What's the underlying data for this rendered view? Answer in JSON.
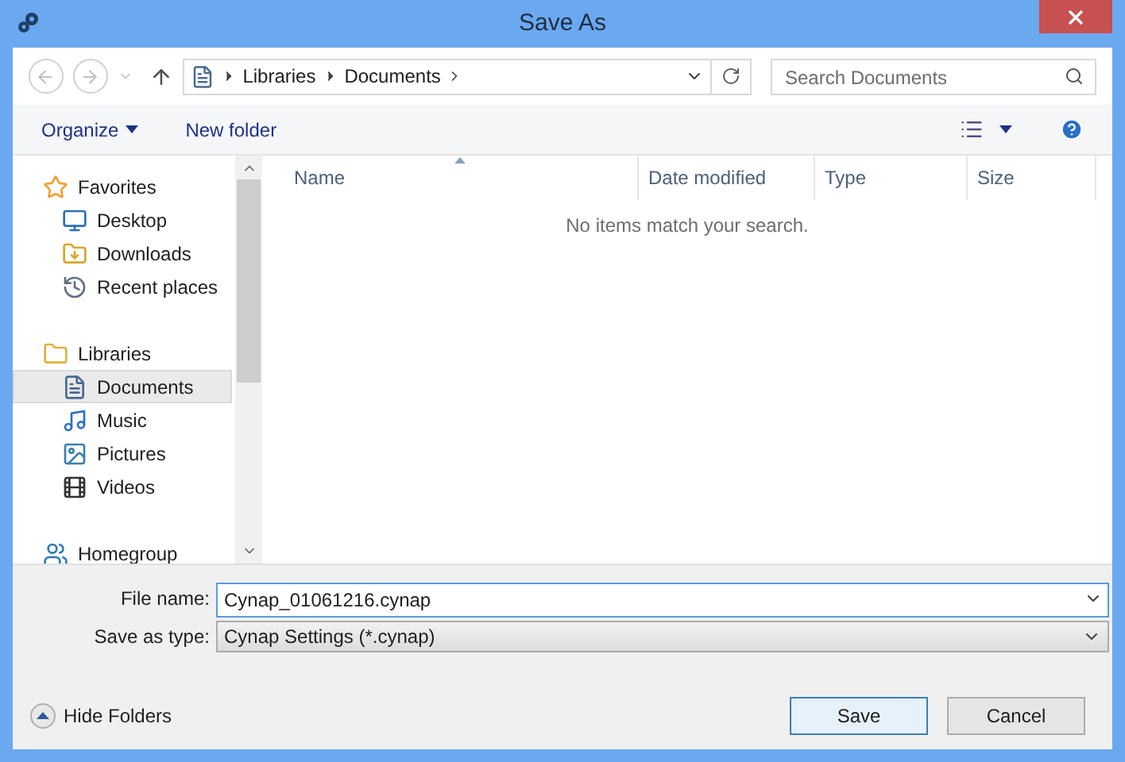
{
  "window": {
    "title": "Save As"
  },
  "nav": {
    "back_disabled": true,
    "forward_disabled": true,
    "breadcrumb": [
      "Libraries",
      "Documents"
    ],
    "search": {
      "placeholder": "Search Documents"
    }
  },
  "toolbar": {
    "organize": "Organize",
    "new_folder": "New folder"
  },
  "sidebar": {
    "items": [
      {
        "label": "Favorites",
        "kind": "star",
        "selected": false,
        "children": [
          {
            "label": "Desktop",
            "kind": "desktop",
            "selected": false
          },
          {
            "label": "Downloads",
            "kind": "downloads",
            "selected": false
          },
          {
            "label": "Recent places",
            "kind": "recent",
            "selected": false
          }
        ]
      },
      {
        "label": "Libraries",
        "kind": "library",
        "selected": false,
        "children": [
          {
            "label": "Documents",
            "kind": "document",
            "selected": true
          },
          {
            "label": "Music",
            "kind": "music",
            "selected": false
          },
          {
            "label": "Pictures",
            "kind": "pictures",
            "selected": false
          },
          {
            "label": "Videos",
            "kind": "videos",
            "selected": false
          }
        ]
      },
      {
        "label": "Homegroup",
        "kind": "homegroup",
        "selected": false
      }
    ]
  },
  "table": {
    "columns": [
      "Name",
      "Date modified",
      "Type",
      "Size"
    ],
    "empty_message": "No items match your search."
  },
  "fields": {
    "file_name": {
      "label": "File name:",
      "value": "Cynap_01061216.cynap"
    },
    "save_type": {
      "label": "Save as type:",
      "value": "Cynap Settings (*.cynap)"
    }
  },
  "hide_folders": "Hide Folders",
  "buttons": [
    "Save",
    "Cancel"
  ]
}
